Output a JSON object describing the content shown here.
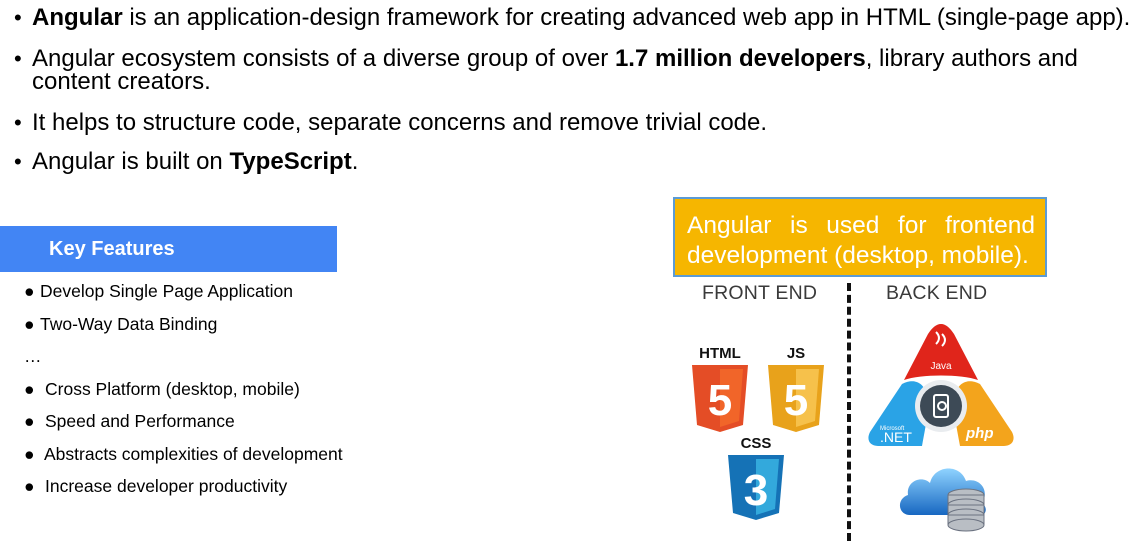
{
  "bullets": [
    {
      "bold_lead": "Angular",
      "text": " is an application-design framework for creating advanced web app in HTML (single-page app)."
    },
    {
      "pre": "Angular ecosystem consists of a diverse group of over ",
      "bold": "1.7 million developers",
      "post": ", library authors and content creators."
    },
    {
      "text": "It helps to structure code, separate concerns and remove trivial code."
    },
    {
      "pre": "Angular is built on ",
      "bold": "TypeScript",
      "post": "."
    }
  ],
  "bullet_glyph": "•",
  "key_features": {
    "title": "Key Features",
    "items": [
      "Develop Single Page Application",
      "Two-Way Data Binding",
      "…",
      "Cross Platform (desktop, mobile)",
      "Speed and Performance",
      "Abstracts complexities of development",
      "Increase developer productivity"
    ],
    "item_glyph": "●"
  },
  "callout": {
    "text": "Angular is used for frontend development (desktop, mobile)."
  },
  "diagram": {
    "front_label": "FRONT END",
    "back_label": "BACK END",
    "front_icons": {
      "html": "HTML",
      "js": "JS",
      "css": "CSS"
    },
    "back_icons": {
      "java": "Java",
      "net": ".NET",
      "net_small": "Microsoft",
      "php": "php"
    }
  },
  "colors": {
    "header_blue": "#4285f4",
    "callout_bg": "#f6b600",
    "callout_border": "#5b9bd5",
    "html5_orange": "#e44d26",
    "js_yellow": "#f0a32a",
    "css3_blue": "#1572b6",
    "java_red": "#e0251b",
    "net_blue": "#2aa3e6",
    "php_orange": "#f3a41c"
  }
}
